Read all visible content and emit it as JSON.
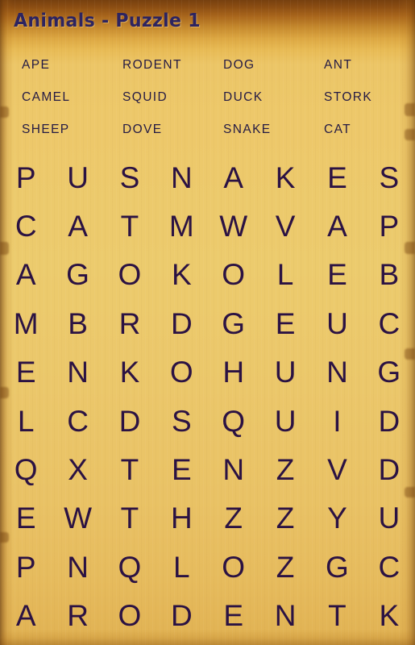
{
  "header": {
    "title": "Animals - Puzzle 1"
  },
  "word_list": {
    "rows": [
      [
        "APE",
        "RODENT",
        "DOG",
        "ANT"
      ],
      [
        "CAMEL",
        "SQUID",
        "DUCK",
        "STORK"
      ],
      [
        "SHEEP",
        "DOVE",
        "SNAKE",
        "CAT"
      ]
    ],
    "words": [
      "APE",
      "RODENT",
      "DOG",
      "ANT",
      "CAMEL",
      "SQUID",
      "DUCK",
      "STORK",
      "SHEEP",
      "DOVE",
      "SNAKE",
      "CAT"
    ]
  },
  "grid": {
    "columns": 8,
    "rows": 10,
    "letters": [
      [
        "P",
        "U",
        "S",
        "N",
        "A",
        "K",
        "E",
        "S"
      ],
      [
        "C",
        "A",
        "T",
        "M",
        "W",
        "V",
        "A",
        "P"
      ],
      [
        "A",
        "G",
        "O",
        "K",
        "O",
        "L",
        "E",
        "B"
      ],
      [
        "M",
        "B",
        "R",
        "D",
        "G",
        "E",
        "U",
        "C"
      ],
      [
        "E",
        "N",
        "K",
        "O",
        "H",
        "U",
        "N",
        "G"
      ],
      [
        "L",
        "C",
        "D",
        "S",
        "Q",
        "U",
        "I",
        "D"
      ],
      [
        "Q",
        "X",
        "T",
        "E",
        "N",
        "Z",
        "V",
        "D"
      ],
      [
        "E",
        "W",
        "T",
        "H",
        "Z",
        "Z",
        "Y",
        "U"
      ],
      [
        "P",
        "N",
        "Q",
        "L",
        "O",
        "Z",
        "G",
        "C"
      ],
      [
        "A",
        "R",
        "O",
        "D",
        "E",
        "N",
        "T",
        "K"
      ]
    ]
  },
  "colors": {
    "paper_top": "#77400f",
    "paper_body": "#ecc768",
    "paper_bottom": "#d9a848",
    "title_text": "#2d2460",
    "word_text": "#241a44",
    "grid_letter": "#2b1243"
  }
}
